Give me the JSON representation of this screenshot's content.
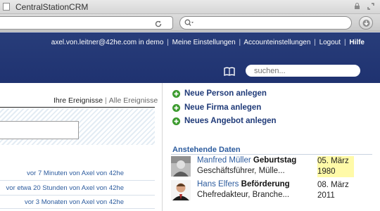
{
  "browser": {
    "window_title": "CentralStationCRM"
  },
  "header": {
    "user_links": [
      "axel.von.leitner@42he.com in demo",
      "Meine Einstellungen",
      "Accounteinstellungen",
      "Logout",
      "Hilfe"
    ],
    "separator": "|",
    "search_placeholder": "suchen..."
  },
  "events": {
    "tab_own": "Ihre Ereignisse",
    "tab_sep": "|",
    "tab_all": "Alle Ereignisse",
    "activities": [
      {
        "time": "vor 7 Minuten",
        "by": "von Axel von 42he"
      },
      {
        "time": "vor etwa 20 Stunden",
        "by": "von Axel von 42he"
      },
      {
        "time": "vor 3 Monaten",
        "by": "von Axel von 42he"
      }
    ]
  },
  "actions": {
    "new_person": "Neue Person anlegen",
    "new_company": "Neue Firma anlegen",
    "new_offer": "Neues Angebot anlegen"
  },
  "upcoming": {
    "title": "Anstehende Daten",
    "items": [
      {
        "name": "Manfred Müller",
        "event": "Geburtstag",
        "role": "Geschäftsführer, Mülle...",
        "date_line1": "05. März",
        "date_line2": "1980",
        "highlight": true
      },
      {
        "name": "Hans Elfers",
        "event": "Beförderung",
        "role": "Chefredakteur, Branche...",
        "date_line1": "08. März",
        "date_line2": "2011",
        "highlight": false
      }
    ]
  },
  "colors": {
    "header_bg": "#243873",
    "link_blue": "#2d5c9e",
    "action_plus": "#3a9a2c",
    "date_highlight": "#fffaa8"
  }
}
